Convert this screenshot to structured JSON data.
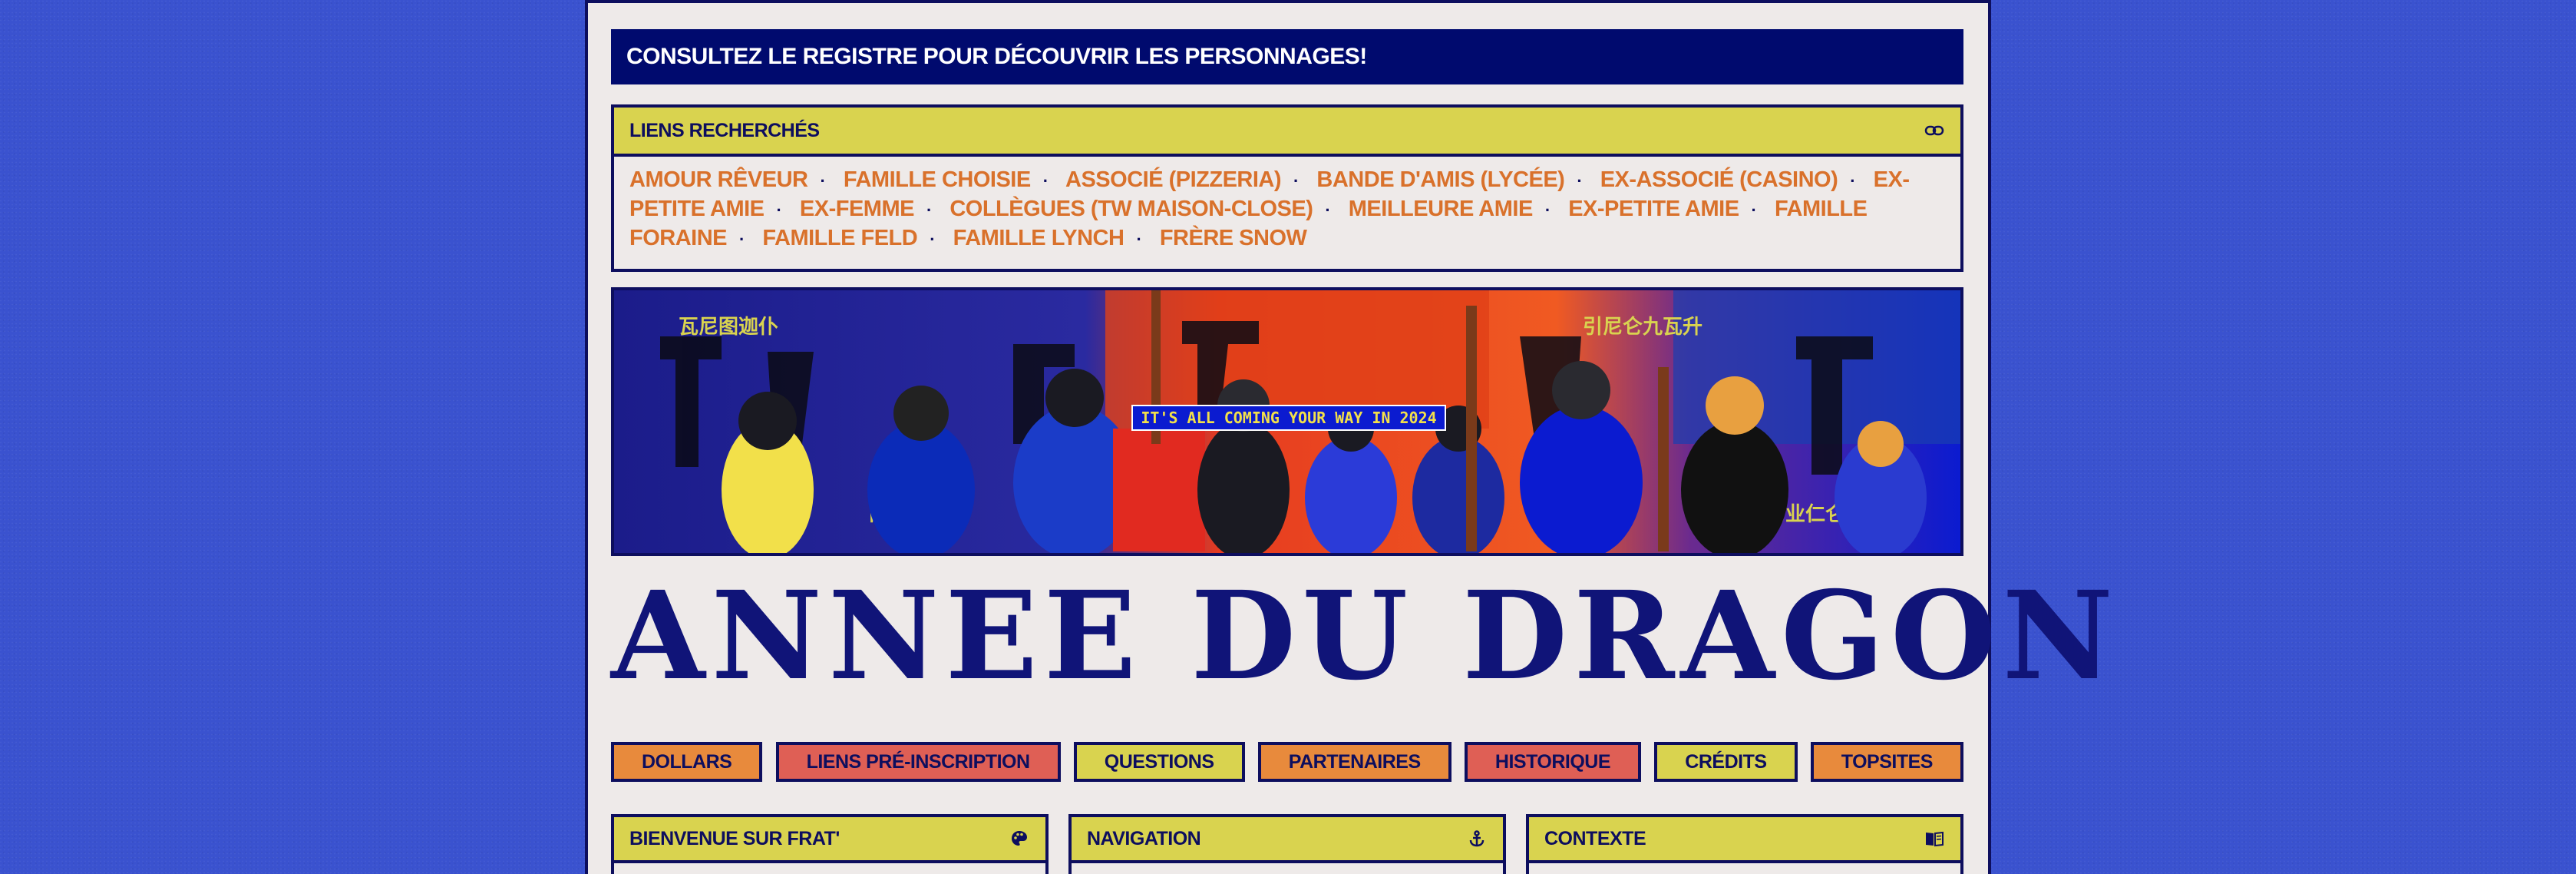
{
  "top_banner": {
    "text": "CONSULTEZ LE REGISTRE POUR DÉCOUVRIR LES PERSONNAGES!"
  },
  "links": {
    "title": "LIENS RECHERCHÉS",
    "icon": "link-icon",
    "items": [
      "AMOUR RÊVEUR",
      "FAMILLE CHOISIE",
      "ASSOCIÉ (PIZZERIA)",
      "BANDE D'AMIS (LYCÉE)",
      "EX-ASSOCIÉ (CASINO)",
      "EX-PETITE AMIE",
      "EX-FEMME",
      "COLLÈGUES (TW MAISON-CLOSE)",
      "MEILLEURE AMIE",
      "EX-PETITE AMIE",
      "FAMILLE FORAINE",
      "FAMILLE FELD",
      "FAMILLE LYNCH",
      "FRÈRE SNOW"
    ],
    "separator": "·"
  },
  "hero": {
    "caption": "IT'S ALL COMING YOUR WAY IN 2024",
    "accent_colors": [
      "#e63b1f",
      "#0b1bd0",
      "#f2e04a",
      "#111111"
    ]
  },
  "site_title": "ANNEE DU DRAGON",
  "nav": [
    {
      "label": "DOLLARS",
      "color": "#e88a3c"
    },
    {
      "label": "LIENS PRÉ-INSCRIPTION",
      "color": "#df5f55"
    },
    {
      "label": "QUESTIONS",
      "color": "#d9d34f"
    },
    {
      "label": "PARTENAIRES",
      "color": "#e88a3c"
    },
    {
      "label": "HISTORIQUE",
      "color": "#df5f55"
    },
    {
      "label": "CRÉDITS",
      "color": "#d9d34f"
    },
    {
      "label": "TOPSITES",
      "color": "#e88a3c"
    }
  ],
  "panels": [
    {
      "title": "BIENVENUE SUR FRAT'",
      "icon": "palette-icon"
    },
    {
      "title": "NAVIGATION",
      "icon": "anchor-icon"
    },
    {
      "title": "CONTEXTE",
      "icon": "book-icon"
    }
  ]
}
